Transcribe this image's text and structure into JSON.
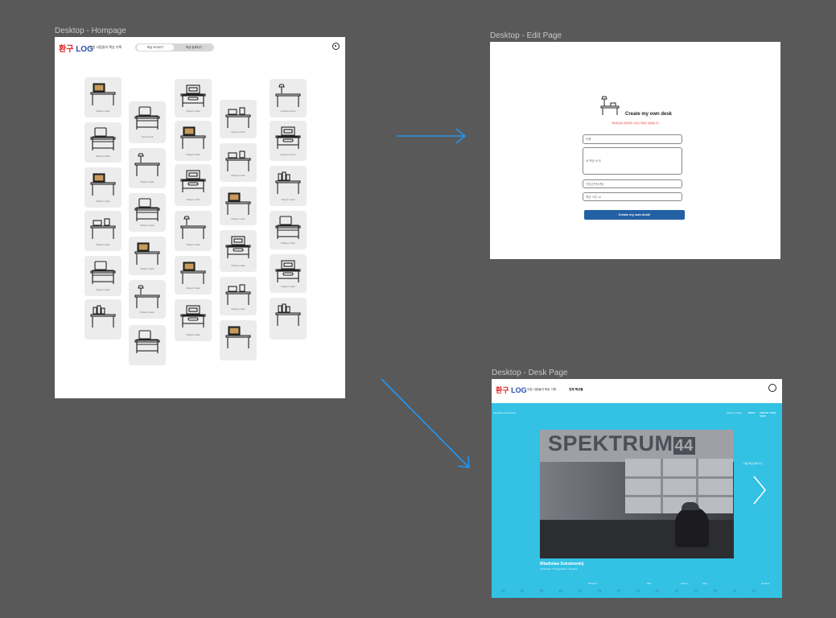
{
  "canvas": {
    "background": "#595959",
    "arrow_color": "#2196f3"
  },
  "frames": {
    "home": {
      "label": "Desktop - Hompage"
    },
    "edit": {
      "label": "Desktop - Edit Page"
    },
    "desk": {
      "label": "Desktop - Desk Page"
    }
  },
  "home": {
    "logo_red": "환구",
    "logo_blue": "LOG",
    "tagline": "아침 사람들의 책상 기록",
    "toggle": {
      "active": "책상 모아보기",
      "other": "책상 등록하기"
    },
    "profile_icon": "user-circle-icon",
    "cards": [
      {
        "caption": "Whajun's Desk",
        "icon": "desk-monitor-icon"
      },
      {
        "caption": "Wahyun's Desk",
        "icon": "desk-computer-icon"
      },
      {
        "caption": "Whajun's Desk",
        "icon": "desk-monitor-icon"
      },
      {
        "caption": "Whajun's Desk",
        "icon": "desk-chair-icon"
      },
      {
        "caption": "Whajun's Desk",
        "icon": "desk-computer-icon"
      },
      {
        "caption": "",
        "icon": "desk-books-icon"
      },
      {
        "caption": "Karly's Desk",
        "icon": "desk-computer-icon"
      },
      {
        "caption": "Whajun's Desk",
        "icon": "desk-lamp-icon"
      },
      {
        "caption": "Whajun's Desk",
        "icon": "desk-computer-icon"
      },
      {
        "caption": "Whajun's Desk",
        "icon": "desk-monitor-icon"
      },
      {
        "caption": "Whajun's Desk",
        "icon": "desk-lamp-icon"
      },
      {
        "caption": "",
        "icon": "desk-computer-icon"
      },
      {
        "caption": "Whajun's Desk",
        "icon": "desk-laptop-icon"
      },
      {
        "caption": "Whajun's Desk",
        "icon": "desk-monitor-icon"
      },
      {
        "caption": "Whajun's Desk",
        "icon": "desk-laptop-icon"
      },
      {
        "caption": "Whajun's Desk",
        "icon": "desk-lamp-icon"
      },
      {
        "caption": "Whajun's Desk",
        "icon": "desk-monitor-icon"
      },
      {
        "caption": "Whajun's Desk",
        "icon": "desk-laptop-icon"
      },
      {
        "caption": "Sehyun's Desk",
        "icon": "desk-chair-icon"
      },
      {
        "caption": "Whajun's Desk",
        "icon": "desk-chair-icon"
      },
      {
        "caption": "Whajun's Desk",
        "icon": "desk-monitor-icon"
      },
      {
        "caption": "Whajun's Desk",
        "icon": "desk-laptop-icon"
      },
      {
        "caption": "Whajun's Desk",
        "icon": "desk-chair-icon"
      },
      {
        "caption": "",
        "icon": "desk-monitor-icon"
      },
      {
        "caption": "Kimberly's Desk",
        "icon": "desk-lamp-icon"
      },
      {
        "caption": "Dongmin's Desk",
        "icon": "desk-laptop-icon"
      },
      {
        "caption": "Whajun's Desk",
        "icon": "desk-books-icon"
      },
      {
        "caption": "Whajun's Desk",
        "icon": "desk-computer-icon"
      },
      {
        "caption": "Whajun's Desk",
        "icon": "desk-laptop-icon"
      },
      {
        "caption": "",
        "icon": "desk-books-icon"
      }
    ]
  },
  "edit": {
    "title": "Create my own desk",
    "subtitle": "책상정보를 입력하면 나만의 책상이 생성됩니다",
    "name_placeholder": "이름",
    "intro_placeholder": "내 책상 소개",
    "field3_placeholder": "직업(선택사항)",
    "field4_placeholder": "책상 사진 url",
    "submit_label": "Create my own desk!",
    "accent": "#2460a4"
  },
  "desk": {
    "logo_red": "환구",
    "logo_blue": "LOG",
    "tagline": "아침 사람들의 책상 기록",
    "nav_label": "전체 책상들",
    "left_small": "Wladislaw Sokolowskij",
    "right_links": [
      "Whajun's Desk",
      "ABOUT",
      "CREATE YOUR DESK"
    ],
    "photo_sign": "SPEKTRUM",
    "photo_sign_num": "44",
    "owner_name": "Wladislaw Sokolowskij",
    "owner_sub": "Art Director / Photographer / Designer",
    "next_label": "다른 책상 보러가기",
    "strip_labels": [
      "Whajun's",
      "Wah",
      "Sehyun",
      "Karly",
      "Kimberly"
    ],
    "bg": "#33c1e4"
  }
}
